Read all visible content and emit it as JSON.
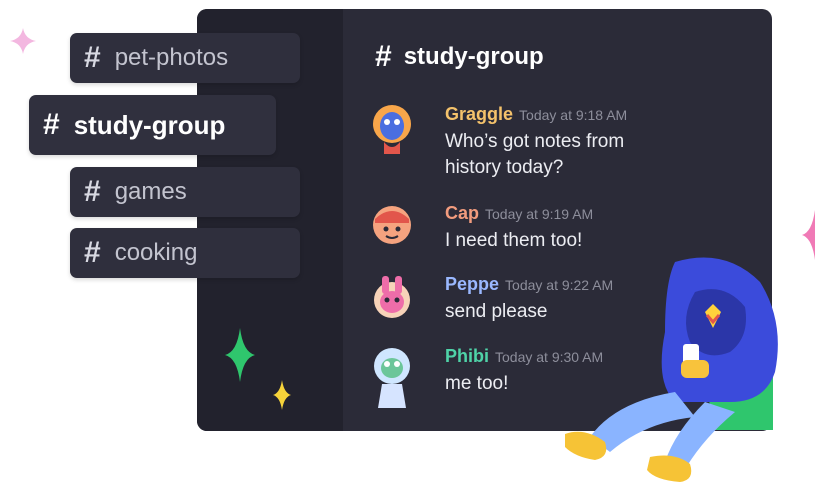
{
  "sidebar": {
    "channels": [
      {
        "name": "pet-photos",
        "active": false
      },
      {
        "name": "study-group",
        "active": true
      },
      {
        "name": "games",
        "active": false
      },
      {
        "name": "cooking",
        "active": false
      }
    ],
    "hash_symbol": "#"
  },
  "header": {
    "channel_name": "study-group"
  },
  "messages": [
    {
      "author": "Graggle",
      "time": "Today at 9:18 AM",
      "text": "Who’s got notes from history today?",
      "color": "#f4c26b"
    },
    {
      "author": "Cap",
      "time": "Today at 9:19 AM",
      "text": "I need them too!",
      "color": "#f29c7e"
    },
    {
      "author": "Peppe",
      "time": "Today at 9:22 AM",
      "text": "send please",
      "color": "#9ab8ff"
    },
    {
      "author": "Phibi",
      "time": "Today at 9:30 AM",
      "text": "me too!",
      "color": "#4fd3a8"
    }
  ],
  "colors": {
    "panel": "#2b2b38",
    "sidebar": "#22222d",
    "sparkle_green": "#2fc66d",
    "sparkle_yellow": "#f6d33a",
    "sparkle_pink": "#f07ab6"
  }
}
